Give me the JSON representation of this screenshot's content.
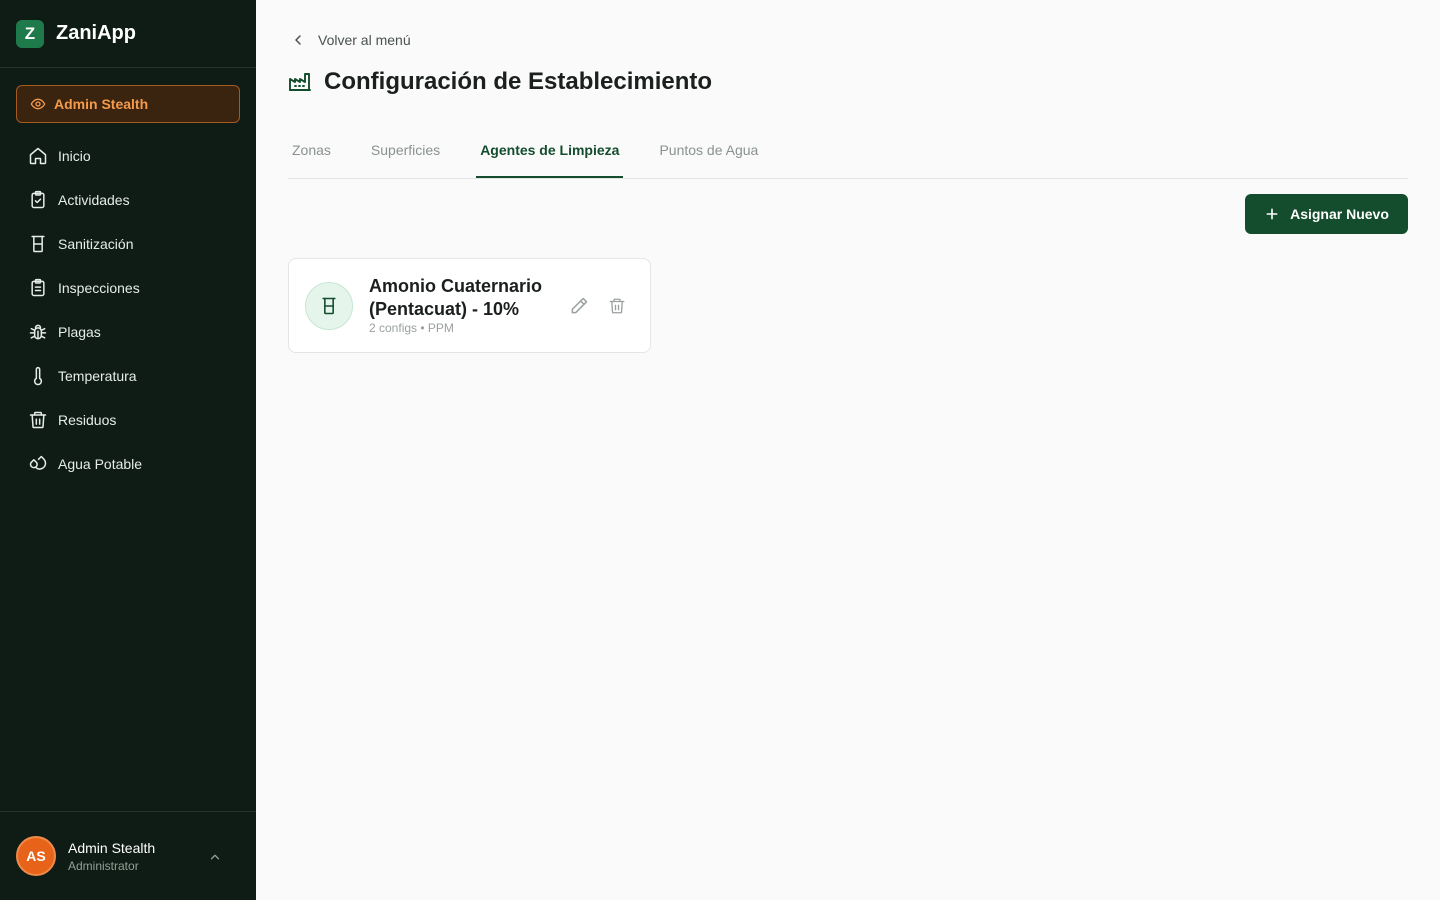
{
  "brand": {
    "logo_letter": "Z",
    "name": "ZaniApp"
  },
  "stealth": {
    "label": "Admin Stealth"
  },
  "nav": {
    "items": [
      {
        "label": "Inicio",
        "icon": "home-icon"
      },
      {
        "label": "Actividades",
        "icon": "clipboard-check-icon"
      },
      {
        "label": "Sanitización",
        "icon": "beaker-icon"
      },
      {
        "label": "Inspecciones",
        "icon": "clipboard-list-icon"
      },
      {
        "label": "Plagas",
        "icon": "bug-icon"
      },
      {
        "label": "Temperatura",
        "icon": "thermometer-icon"
      },
      {
        "label": "Residuos",
        "icon": "trash-icon"
      },
      {
        "label": "Agua Potable",
        "icon": "droplets-icon"
      }
    ]
  },
  "user": {
    "initials": "AS",
    "name": "Admin Stealth",
    "role": "Administrator"
  },
  "main": {
    "back_label": "Volver al menú",
    "title": "Configuración de Establecimiento",
    "tabs": [
      {
        "label": "Zonas",
        "active": false
      },
      {
        "label": "Superficies",
        "active": false
      },
      {
        "label": "Agentes de Limpieza",
        "active": true
      },
      {
        "label": "Puntos de Agua",
        "active": false
      }
    ],
    "assign_label": "Asignar Nuevo",
    "card": {
      "title": "Amonio Cuaternario (Pentacuat) - 10%",
      "subtitle": "2 configs • PPM"
    }
  },
  "colors": {
    "sidebar_bg": "#0f1c15",
    "primary": "#144d2d",
    "accent_orange": "#f59a4a",
    "avatar": "#e8631a"
  }
}
